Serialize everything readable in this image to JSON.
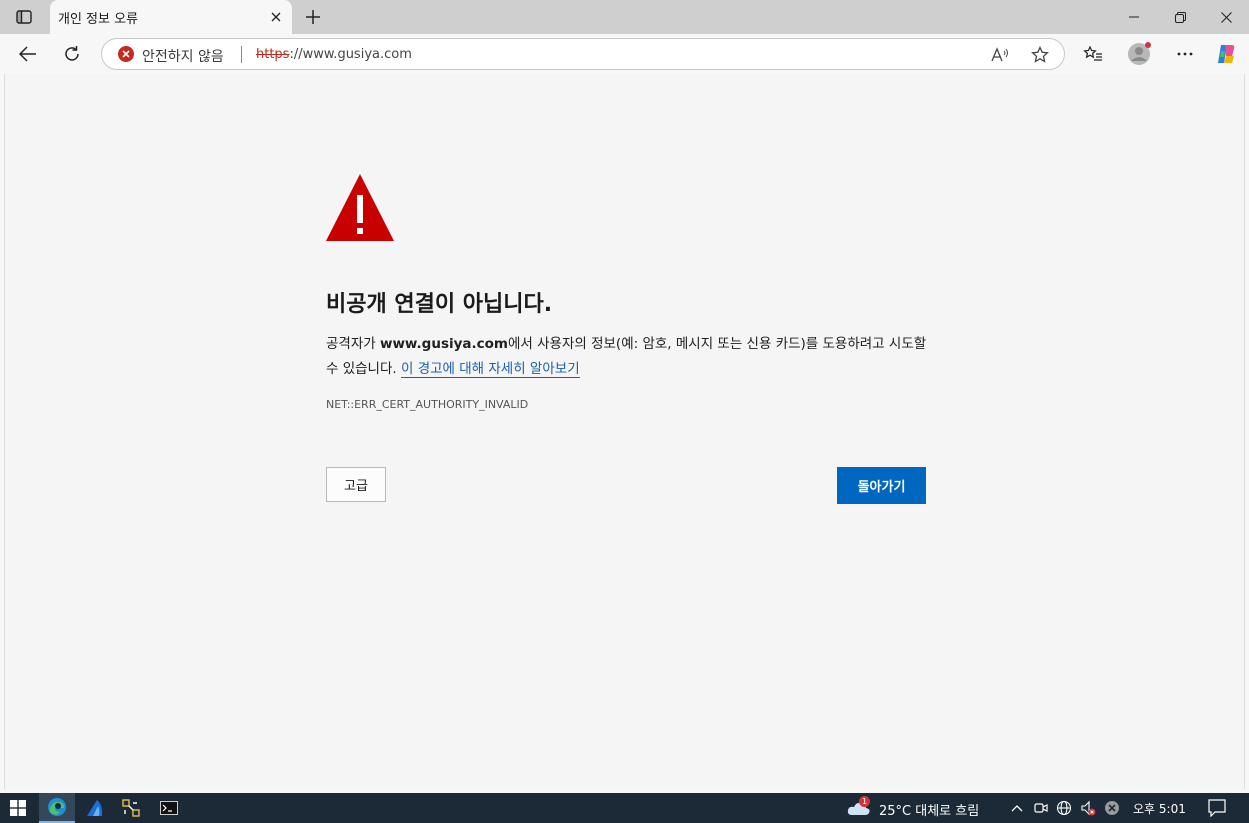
{
  "browser": {
    "tab_title": "개인 정보 오류",
    "security_label": "안전하지 않음",
    "url_scheme": "https",
    "url_rest": "://www.gusiya.com"
  },
  "page": {
    "heading": "비공개 연결이 아닙니다.",
    "desc_prefix": "공격자가 ",
    "desc_domain": "www.gusiya.com",
    "desc_suffix": "에서 사용자의 정보(예: 암호, 메시지 또는 신용 카드)를 도용하려고 시도할 수 있습니다. ",
    "learn_more": "이 경고에 대해 자세히 알아보기",
    "error_code": "NET::ERR_CERT_AUTHORITY_INVALID",
    "advanced_label": "고급",
    "back_label": "돌아가기"
  },
  "taskbar": {
    "weather": "25°C  대체로 흐림",
    "weather_badge": "1",
    "clock": "오후 5:01"
  },
  "colors": {
    "warning_red": "#c80000",
    "primary_button": "#0067c0",
    "link": "#1a5fa8"
  }
}
